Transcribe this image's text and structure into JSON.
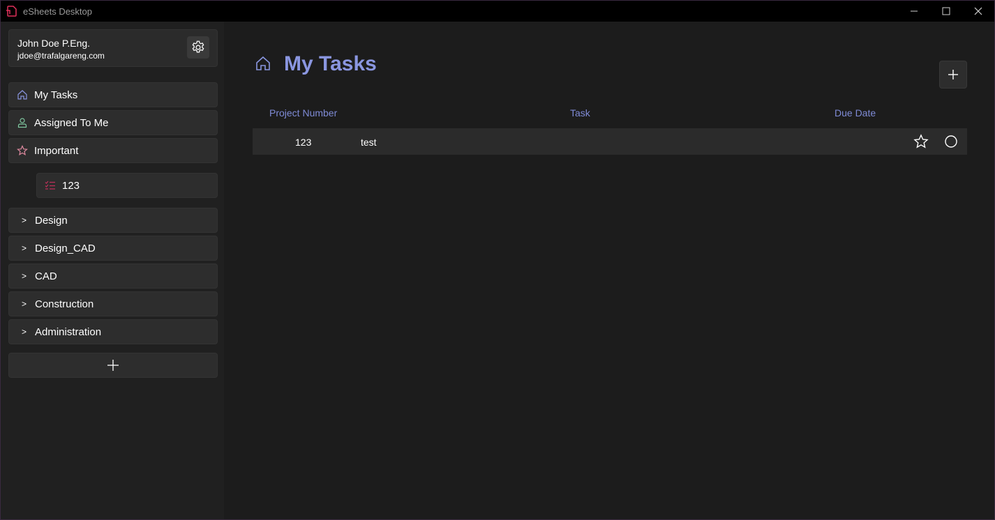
{
  "window": {
    "title": "eSheets Desktop",
    "accent_color": "#8a96e0",
    "brand_color": "#e0305a"
  },
  "user": {
    "name": "John Doe P.Eng.",
    "email": "jdoe@trafalgareng.com"
  },
  "sidebar": {
    "nav": [
      {
        "label": "My Tasks",
        "icon": "home-icon"
      },
      {
        "label": "Assigned To Me",
        "icon": "person-icon"
      },
      {
        "label": "Important",
        "icon": "star-icon"
      }
    ],
    "sub_item": {
      "label": "123",
      "icon": "task-list-icon"
    },
    "groups": [
      {
        "arrow": ">",
        "label": "Design"
      },
      {
        "arrow": ">",
        "label": "Design_CAD"
      },
      {
        "arrow": ">",
        "label": "CAD"
      },
      {
        "arrow": ">",
        "label": "Construction"
      },
      {
        "arrow": ">",
        "label": "Administration"
      }
    ]
  },
  "main": {
    "title": "My Tasks",
    "columns": {
      "project_number": "Project Number",
      "task": "Task",
      "due_date": "Due Date"
    },
    "rows": [
      {
        "project_number": "123",
        "task": "test",
        "due_date": ""
      }
    ]
  }
}
